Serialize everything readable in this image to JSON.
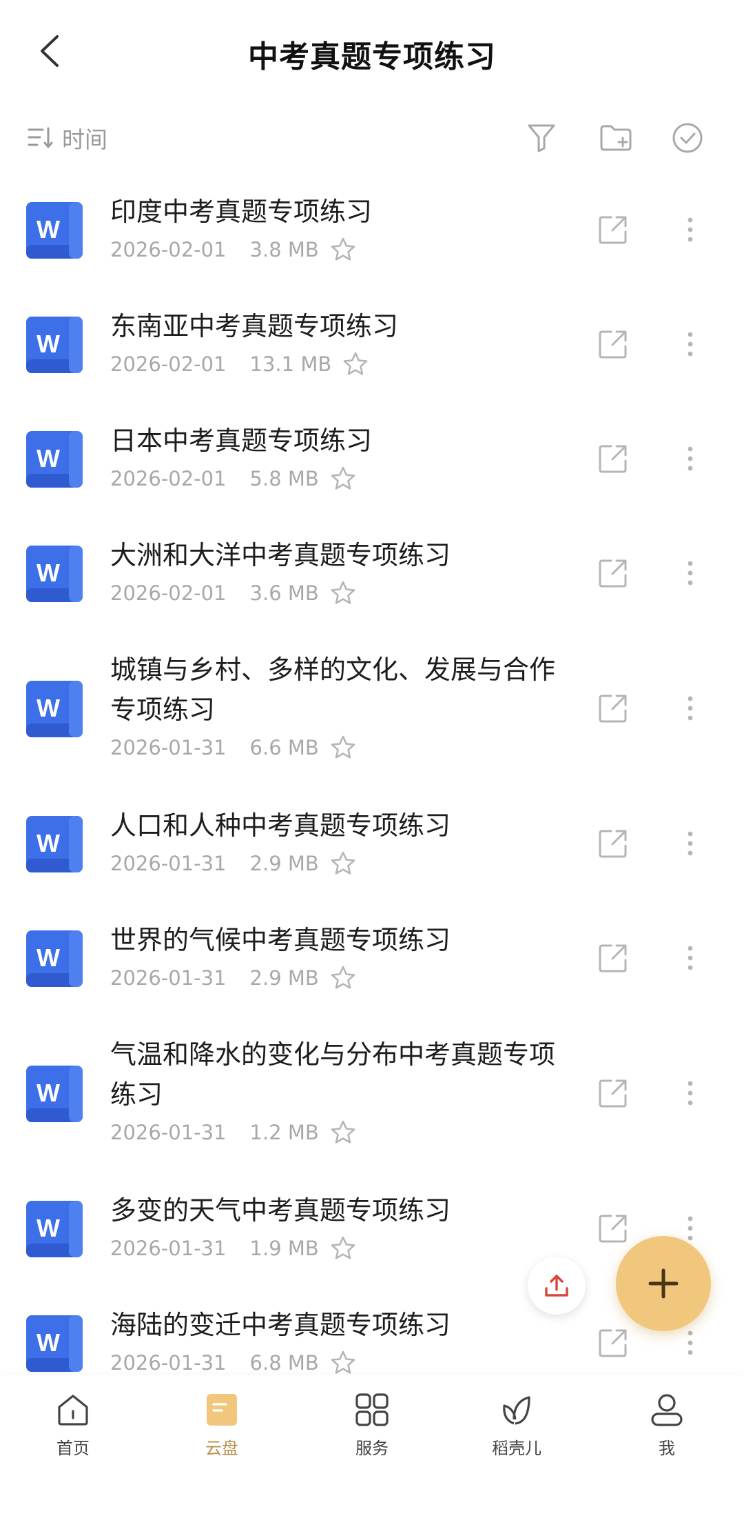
{
  "header": {
    "title": "中考真题专项练习"
  },
  "toolbar": {
    "sort_label": "时间"
  },
  "files": [
    {
      "name": "印度中考真题专项练习",
      "date": "2026-02-01",
      "size": "3.8 MB",
      "icon": "W"
    },
    {
      "name": "东南亚中考真题专项练习",
      "date": "2026-02-01",
      "size": "13.1 MB",
      "icon": "W"
    },
    {
      "name": "日本中考真题专项练习",
      "date": "2026-02-01",
      "size": "5.8 MB",
      "icon": "W"
    },
    {
      "name": "大洲和大洋中考真题专项练习",
      "date": "2026-02-01",
      "size": "3.6 MB",
      "icon": "W"
    },
    {
      "name": "城镇与乡村、多样的文化、发展与合作专项练习",
      "date": "2026-01-31",
      "size": "6.6 MB",
      "icon": "W"
    },
    {
      "name": "人口和人种中考真题专项练习",
      "date": "2026-01-31",
      "size": "2.9 MB",
      "icon": "W"
    },
    {
      "name": "世界的气候中考真题专项练习",
      "date": "2026-01-31",
      "size": "2.9 MB",
      "icon": "W"
    },
    {
      "name": "气温和降水的变化与分布中考真题专项练习",
      "date": "2026-01-31",
      "size": "1.2 MB",
      "icon": "W"
    },
    {
      "name": "多变的天气中考真题专项练习",
      "date": "2026-01-31",
      "size": "1.9 MB",
      "icon": "W"
    },
    {
      "name": "海陆的变迁中考真题专项练习",
      "date": "2026-01-31",
      "size": "6.8 MB",
      "icon": "W"
    }
  ],
  "nav": [
    {
      "label": "首页",
      "icon": "home-icon",
      "active": false
    },
    {
      "label": "云盘",
      "icon": "cloud-drive-icon",
      "active": true
    },
    {
      "label": "服务",
      "icon": "grid-icon",
      "active": false
    },
    {
      "label": "稻壳儿",
      "icon": "leaf-icon",
      "active": false
    },
    {
      "label": "我",
      "icon": "user-icon",
      "active": false
    }
  ],
  "colors": {
    "accent": "#f0c77c",
    "active_nav": "#b8904a",
    "word_blue": "#3d6fe8",
    "upload_red": "#d9463a"
  }
}
